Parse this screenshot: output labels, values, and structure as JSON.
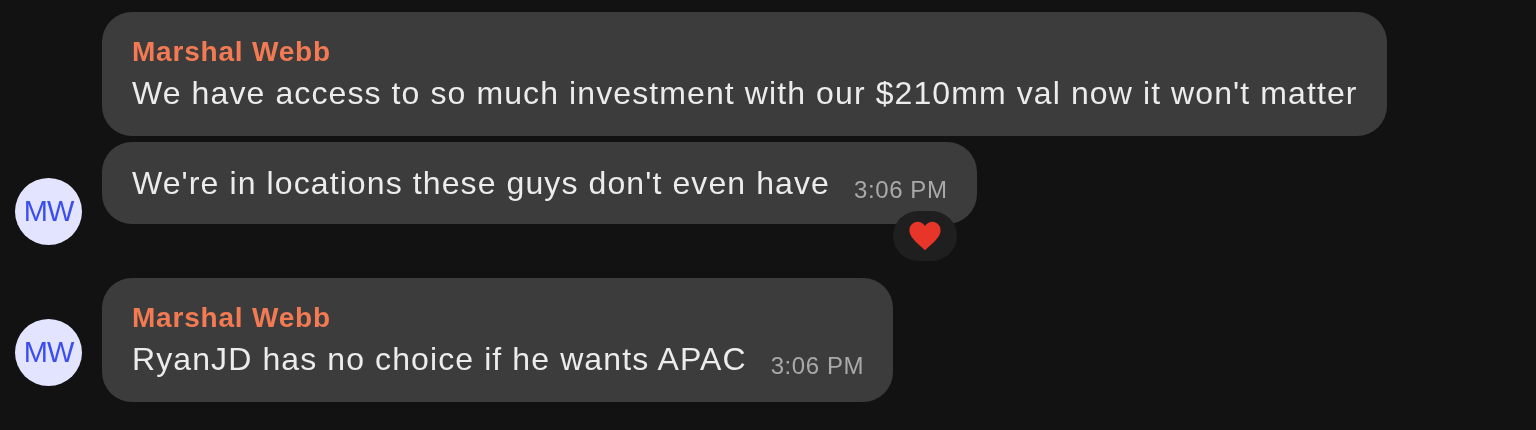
{
  "groups": [
    {
      "avatar": "MW",
      "messages": [
        {
          "sender": "Marshal Webb",
          "text": "We have access to so much investment with our $210mm val now it won't matter"
        },
        {
          "text": "We're in locations these guys don't even have",
          "time": "3:06 PM",
          "reacted": true
        }
      ]
    },
    {
      "avatar": "MW",
      "messages": [
        {
          "sender": "Marshal Webb",
          "text": "RyanJD has no choice if he wants APAC",
          "time": "3:06 PM"
        }
      ]
    }
  ]
}
